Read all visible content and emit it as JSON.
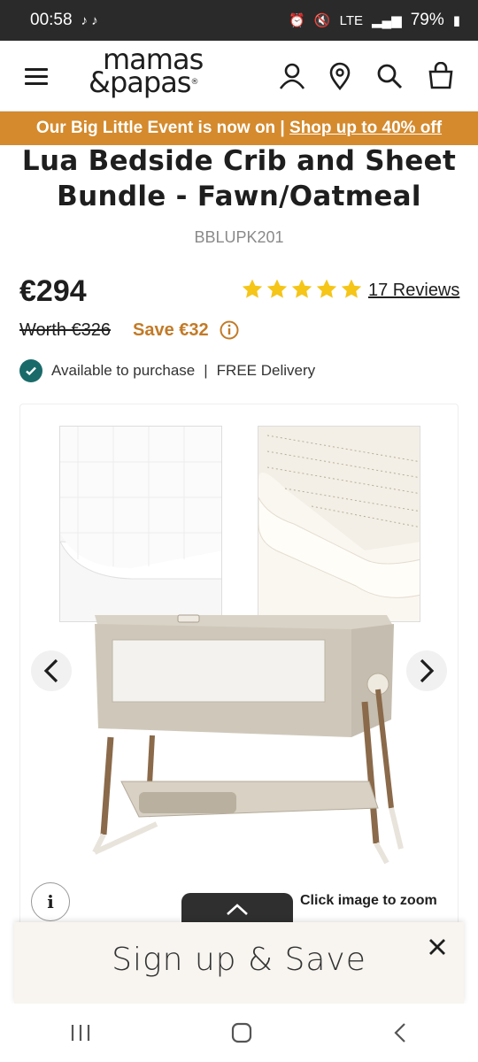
{
  "status_bar": {
    "time": "00:58",
    "battery": "79%",
    "network": "LTE"
  },
  "header": {
    "logo_line1": "mamas",
    "logo_line2": "&papas",
    "logo_reg": "®"
  },
  "promo": {
    "text": "Our Big Little Event is now on | ",
    "link": "Shop up to 40% off"
  },
  "product": {
    "title": "Lua Bedside Crib and Sheet Bundle - Fawn/Oatmeal",
    "sku": "BBLUPK201",
    "price": "€294",
    "rating": 5,
    "reviews": "17 Reviews",
    "worth": "Worth €326",
    "save": "Save €32",
    "availability": "Available to purchase",
    "separator": "|",
    "delivery": "FREE Delivery"
  },
  "gallery": {
    "zoom_hint": "Click image to zoom",
    "info_label": "i"
  },
  "signup": {
    "title": "Sign up & Save"
  },
  "colors": {
    "promo_bg": "#d48a2d",
    "save_text": "#c27a27",
    "star": "#f5c518",
    "check_bg": "#1a6a6a"
  },
  "icons": [
    "menu-icon",
    "user-icon",
    "location-icon",
    "search-icon",
    "bag-icon",
    "star-icon",
    "info-icon",
    "check-icon",
    "chevron-left-icon",
    "chevron-right-icon",
    "chevron-up-icon",
    "close-icon"
  ]
}
